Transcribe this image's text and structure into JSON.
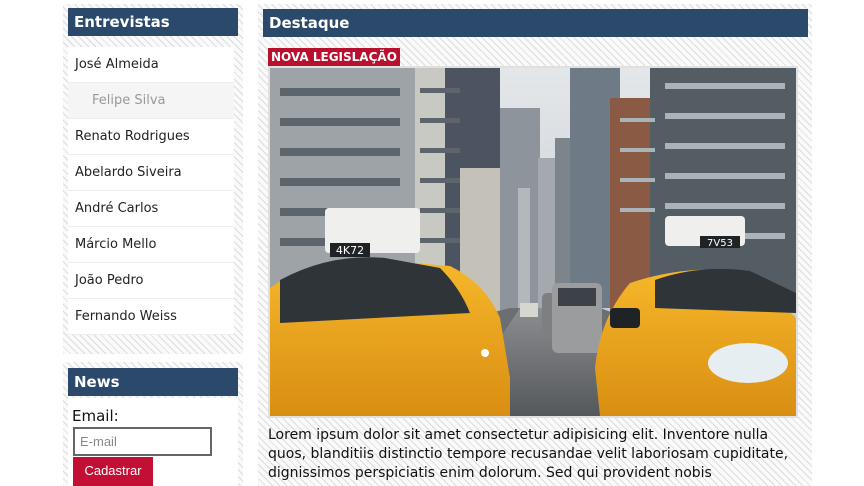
{
  "sidebar": {
    "interviews": {
      "title": "Entrevistas",
      "items": [
        {
          "label": "José Almeida"
        },
        {
          "label": "Felipe Silva"
        },
        {
          "label": "Renato Rodrigues"
        },
        {
          "label": "Abelardo Siveira"
        },
        {
          "label": "André Carlos"
        },
        {
          "label": "Márcio Mello"
        },
        {
          "label": "João Pedro"
        },
        {
          "label": "Fernando Weiss"
        }
      ],
      "active_index": 1
    },
    "news": {
      "title": "News",
      "email_label": "Email:",
      "email_placeholder": "E-mail",
      "submit_label": "Cadastrar"
    }
  },
  "main": {
    "title": "Destaque",
    "badge": "NOVA LEGISLAÇÃO",
    "image_alt": "New York street with yellow taxi cabs",
    "article": "Lorem ipsum dolor sit amet consectetur adipisicing elit. Inventore nulla quos, blanditiis distinctio tempore recusandae velit laboriosam cupiditate, dignissimos perspiciatis enim dolorum. Sed qui provident nobis"
  },
  "colors": {
    "header_bg": "#2b4a6b",
    "accent_red": "#c30f33",
    "taxi_yellow": "#f2a91c"
  }
}
